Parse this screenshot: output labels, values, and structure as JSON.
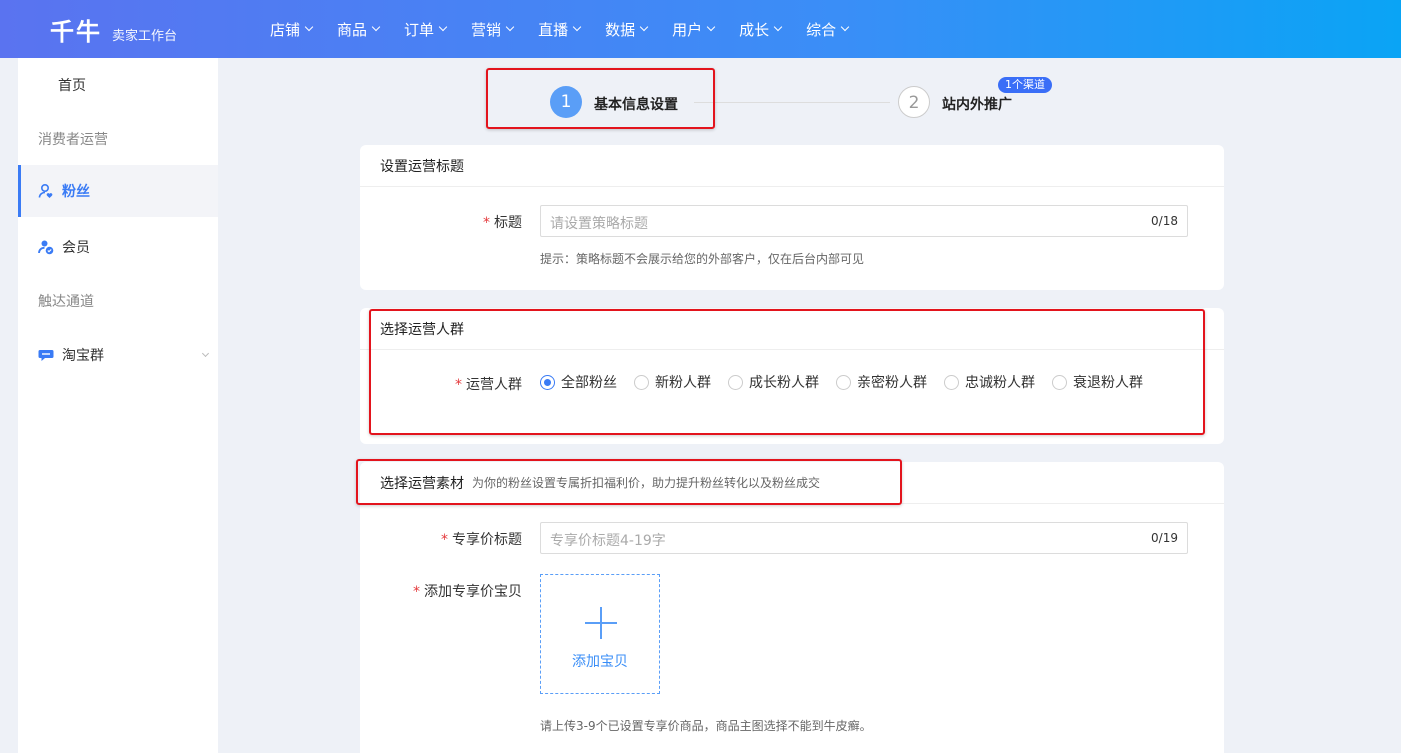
{
  "header": {
    "logo": "千牛",
    "logo_sub": "卖家工作台",
    "nav": [
      {
        "label": "店铺"
      },
      {
        "label": "商品"
      },
      {
        "label": "订单"
      },
      {
        "label": "营销"
      },
      {
        "label": "直播"
      },
      {
        "label": "数据"
      },
      {
        "label": "用户"
      },
      {
        "label": "成长"
      },
      {
        "label": "综合"
      }
    ]
  },
  "sidebar": {
    "home": "首页",
    "group1": "消费者运营",
    "fans": "粉丝",
    "member": "会员",
    "group2": "触达通道",
    "taobao_group": "淘宝群"
  },
  "steps": {
    "step1_num": "1",
    "step1_label": "基本信息设置",
    "step2_num": "2",
    "step2_label": "站内外推广",
    "step2_badge": "1个渠道"
  },
  "title_card": {
    "header": "设置运营标题",
    "label": "标题",
    "placeholder": "请设置策略标题",
    "count": "0/18",
    "hint": "提示：策略标题不会展示给您的外部客户，仅在后台内部可见"
  },
  "crowd_card": {
    "header": "选择运营人群",
    "label": "运营人群",
    "options": [
      "全部粉丝",
      "新粉人群",
      "成长粉人群",
      "亲密粉人群",
      "忠诚粉人群",
      "衰退粉人群"
    ],
    "selected": "全部粉丝"
  },
  "material_card": {
    "header": "选择运营素材",
    "subheader": "为你的粉丝设置专属折扣福利价，助力提升粉丝转化以及粉丝成交",
    "price_title_label": "专享价标题",
    "price_title_placeholder": "专享价标题4-19字",
    "price_title_count": "0/19",
    "add_item_label": "添加专享价宝贝",
    "add_item_button": "添加宝贝",
    "upload_hint": "请上传3-9个已设置专享价商品，商品主图选择不能到牛皮癣。"
  },
  "colors": {
    "accent": "#3a7bf5",
    "annotation_red": "#e3141d",
    "header_gradient_start": "#5a73f0",
    "header_gradient_end": "#0aa4f5"
  }
}
